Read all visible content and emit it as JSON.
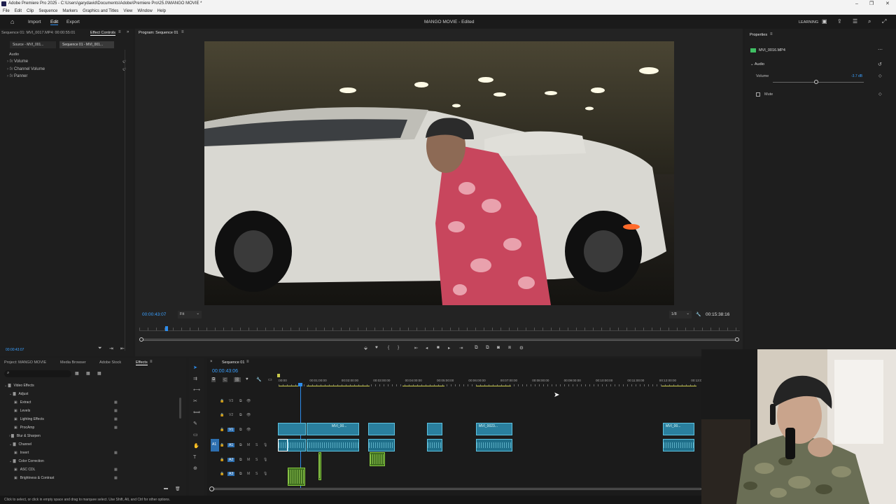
{
  "window": {
    "title": "Adobe Premiere Pro 2025 - C:\\Users\\garydavid\\Documents\\Adobe\\Premiere Pro\\25.0\\MANGO MOVIE *"
  },
  "menu": [
    "File",
    "Edit",
    "Clip",
    "Sequence",
    "Markers",
    "Graphics and Titles",
    "View",
    "Window",
    "Help"
  ],
  "header": {
    "import": "Import",
    "edit": "Edit",
    "export": "Export",
    "project_title": "MANGO MOVIE - Edited",
    "learning": "LEARNING"
  },
  "effect_controls": {
    "tab_source": "Sequence 01: MVI_0017.MP4: 00:00:55:01",
    "tab_effect_controls": "Effect Controls",
    "source_chip": "Source - MVI_001...",
    "seq_chip": "Sequence 01 - MVI_001...",
    "section": "Audio",
    "items": [
      "Volume",
      "Channel Volume",
      "Panner"
    ],
    "timecode": "00:00:43:07"
  },
  "program": {
    "tab": "Program: Sequence 01",
    "timecode": "00:00:43:07",
    "fit": "Fit",
    "resolution": "1/8",
    "duration": "00:15:38:16"
  },
  "properties": {
    "tab": "Properties",
    "clip_name": "MVI_0016.MP4",
    "section": "Audio",
    "volume_label": "Volume",
    "volume_value": "-3.7 dB",
    "mute_label": "Mute"
  },
  "project": {
    "tabs": [
      "Project: MANGO MOVIE",
      "Media Browser",
      "Adobe Stock",
      "Effects"
    ],
    "tree": [
      {
        "label": "Video Effects",
        "level": 0,
        "folder": true
      },
      {
        "label": "Adjust",
        "level": 1,
        "folder": true
      },
      {
        "label": "Extract",
        "level": 2,
        "folder": false
      },
      {
        "label": "Levels",
        "level": 2,
        "folder": false
      },
      {
        "label": "Lighting Effects",
        "level": 2,
        "folder": false
      },
      {
        "label": "ProcAmp",
        "level": 2,
        "folder": false
      },
      {
        "label": "Blur & Sharpen",
        "level": 1,
        "folder": true
      },
      {
        "label": "Channel",
        "level": 1,
        "folder": true
      },
      {
        "label": "Invert",
        "level": 2,
        "folder": false
      },
      {
        "label": "Color Correction",
        "level": 1,
        "folder": true
      },
      {
        "label": "ASC CDL",
        "level": 2,
        "folder": false
      },
      {
        "label": "Brightness & Contrast",
        "level": 2,
        "folder": false
      }
    ]
  },
  "timeline": {
    "tab": "Sequence 01",
    "timecode": "00:00:43:06",
    "ruler": [
      ":00:00",
      "00:01:00:00",
      "00:02:00:00",
      "00:03:00:00",
      "00:04:00:00",
      "00:05:00:00",
      "00:06:00:00",
      "00:07:00:00",
      "00:08:00:00",
      "00:09:00:00",
      "00:10:00:00",
      "00:11:00:00",
      "00:12:00:00",
      "00:13:00:00"
    ],
    "tracks": {
      "video": [
        "V3",
        "V2",
        "V1"
      ],
      "audio": [
        "A1",
        "A2",
        "A3"
      ]
    },
    "clips": [
      "MVI_00...",
      "MVI_0023...",
      "MVI_00..."
    ]
  },
  "status": "Click to select, or click in empty space and drag to marquee select. Use Shift, Alt, and Ctrl for other options.",
  "colors": {
    "accent": "#2d8ceb",
    "clip_video": "#2a7f9e",
    "clip_green": "#3f6e1f",
    "timecode": "#3aa0ff"
  }
}
